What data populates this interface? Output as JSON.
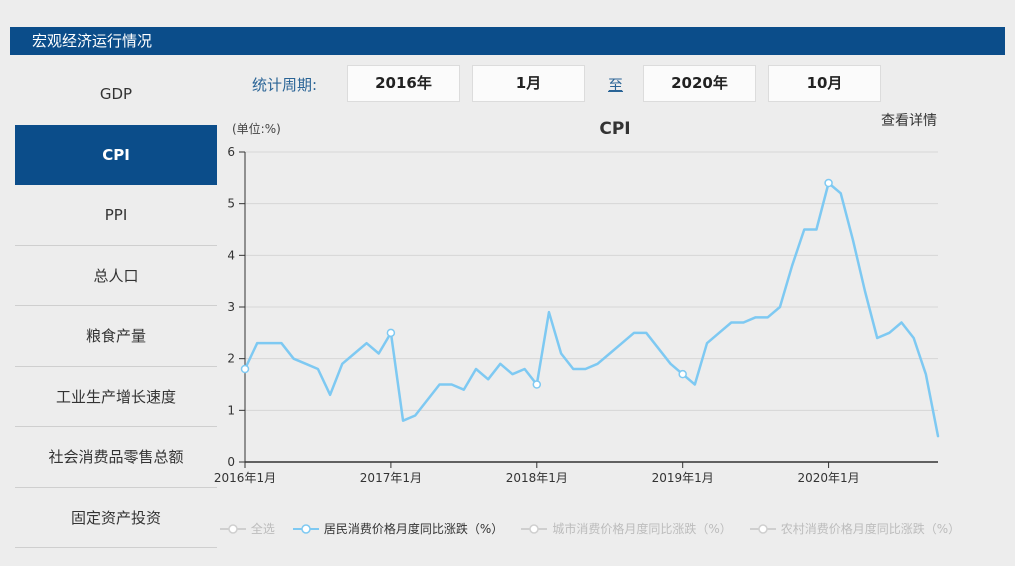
{
  "header": {
    "title": "宏观经济运行情况"
  },
  "sidebar": {
    "items": [
      {
        "key": "gdp",
        "label": "GDP",
        "active": false
      },
      {
        "key": "cpi",
        "label": "CPI",
        "active": true
      },
      {
        "key": "ppi",
        "label": "PPI",
        "active": false
      },
      {
        "key": "total-population",
        "label": "总人口",
        "active": false
      },
      {
        "key": "grain-output",
        "label": "粮食产量",
        "active": false
      },
      {
        "key": "industrial-growth",
        "label": "工业生产增长速度",
        "active": false
      },
      {
        "key": "retail-sales",
        "label": "社会消费品零售总额",
        "active": false
      },
      {
        "key": "fixed-investment",
        "label": "固定资产投资",
        "active": false
      }
    ]
  },
  "period": {
    "label": "统计周期:",
    "start_year": "2016年",
    "start_month": "1月",
    "to_label": "至",
    "end_year": "2020年",
    "end_month": "10月"
  },
  "main": {
    "view_details": "查看详情"
  },
  "chart_data": {
    "type": "line",
    "title": "CPI",
    "unit_label": "(单位:%)",
    "ylim": [
      0,
      6
    ],
    "y_ticks": [
      0,
      1,
      2,
      3,
      4,
      5,
      6
    ],
    "x_start": "2016年1月",
    "x_end": "2020年10月",
    "x_tick_labels": [
      "2016年1月",
      "2017年1月",
      "2018年1月",
      "2019年1月",
      "2020年1月"
    ],
    "x_tick_indices": [
      0,
      12,
      24,
      36,
      48
    ],
    "grid": true,
    "legend_position": "bottom",
    "line_color": "#7ec9f2",
    "inactive_color": "#cfcfcf",
    "series": [
      {
        "name": "居民消费价格月度同比涨跌（%）",
        "values": [
          1.8,
          2.3,
          2.3,
          2.3,
          2.0,
          1.9,
          1.8,
          1.3,
          1.9,
          2.1,
          2.3,
          2.1,
          2.5,
          0.8,
          0.9,
          1.2,
          1.5,
          1.5,
          1.4,
          1.8,
          1.6,
          1.9,
          1.7,
          1.8,
          1.5,
          2.9,
          2.1,
          1.8,
          1.8,
          1.9,
          2.1,
          2.3,
          2.5,
          2.5,
          2.2,
          1.9,
          1.7,
          1.5,
          2.3,
          2.5,
          2.7,
          2.7,
          2.8,
          2.8,
          3.0,
          3.8,
          4.5,
          4.5,
          5.4,
          5.2,
          4.3,
          3.3,
          2.4,
          2.5,
          2.7,
          2.4,
          1.7,
          0.5
        ]
      }
    ],
    "legend": [
      {
        "key": "select-all",
        "label": "全选",
        "active": false
      },
      {
        "key": "resident-cpi",
        "label": "居民消费价格月度同比涨跌（%）",
        "active": true
      },
      {
        "key": "urban-cpi",
        "label": "城市消费价格月度同比涨跌（%）",
        "active": false
      },
      {
        "key": "rural-cpi",
        "label": "农村消费价格月度同比涨跌（%）",
        "active": false
      }
    ]
  }
}
